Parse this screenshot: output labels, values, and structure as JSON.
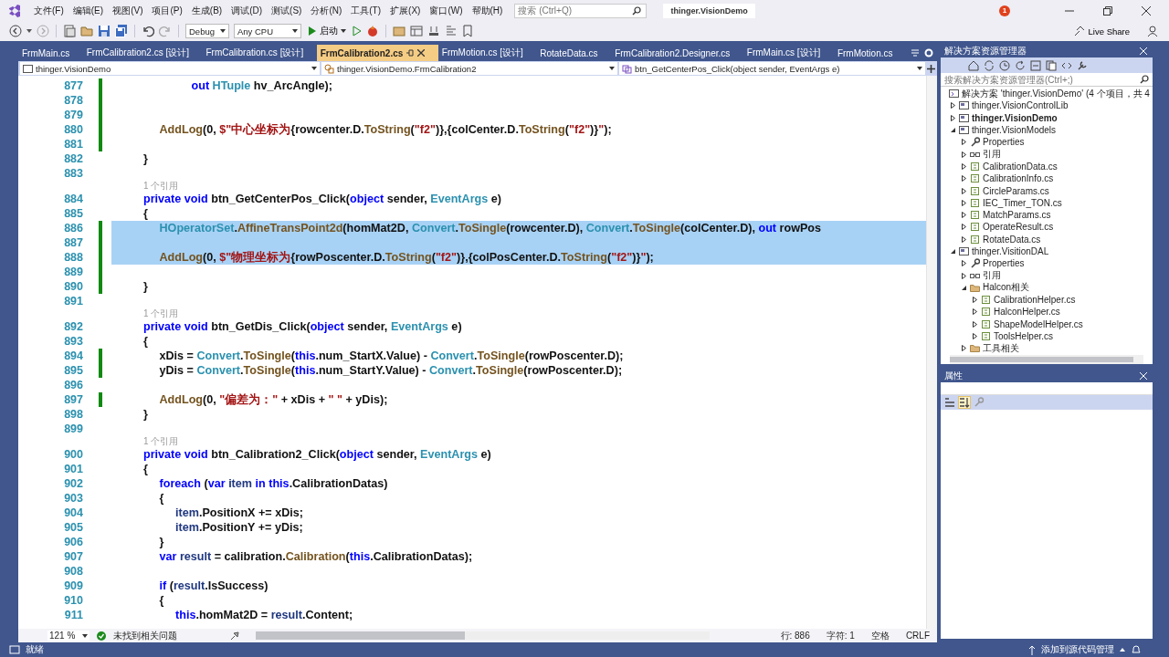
{
  "window": {
    "title": "thinger.VisionDemo",
    "notifications": "1"
  },
  "menu": [
    "文件(F)",
    "编辑(E)",
    "视图(V)",
    "项目(P)",
    "生成(B)",
    "调试(D)",
    "测试(S)",
    "分析(N)",
    "工具(T)",
    "扩展(X)",
    "窗口(W)",
    "帮助(H)"
  ],
  "search": {
    "placeholder": "搜索 (Ctrl+Q)"
  },
  "toolbar": {
    "configuration": "Debug",
    "platform": "Any CPU",
    "start_label": "启动",
    "live_share": "Live Share"
  },
  "tabs": [
    {
      "label": "FrmMain.cs",
      "selected": false
    },
    {
      "label": "FrmCalibration2.cs [设计]",
      "selected": false
    },
    {
      "label": "FrmCalibration.cs [设计]",
      "selected": false
    },
    {
      "label": "FrmCalibration2.cs",
      "selected": true
    },
    {
      "label": "FrmMotion.cs [设计]",
      "selected": false
    },
    {
      "label": "RotateData.cs",
      "selected": false
    },
    {
      "label": "FrmCalibration2.Designer.cs",
      "selected": false
    },
    {
      "label": "FrmMain.cs [设计]",
      "selected": false
    },
    {
      "label": "FrmMotion.cs",
      "selected": false
    }
  ],
  "navigation": {
    "project": "thinger.VisionDemo",
    "class": "thinger.VisionDemo.FrmCalibration2",
    "member": "btn_GetCenterPos_Click(object sender, EventArgs e)"
  },
  "code": {
    "rows": [
      {
        "kind": "line",
        "number": "877",
        "changed": true,
        "selected": false,
        "tokens": [
          {
            "text": "\t\t\t\t\tout ",
            "kind": "kw"
          },
          {
            "text": "HTuple",
            "kind": "type"
          },
          {
            "text": " hv_ArcAngle);",
            "kind": "plain"
          }
        ]
      },
      {
        "kind": "line",
        "number": "878",
        "changed": true,
        "selected": false,
        "tokens": []
      },
      {
        "kind": "line",
        "number": "879",
        "changed": true,
        "selected": false,
        "tokens": []
      },
      {
        "kind": "line",
        "number": "880",
        "changed": true,
        "selected": false,
        "tokens": [
          {
            "text": "\t\t\tAddLog",
            "kind": "method"
          },
          {
            "text": "(0, ",
            "kind": "plain"
          },
          {
            "text": "$\"中心坐标为",
            "kind": "str"
          },
          {
            "text": "{rowcenter.D.",
            "kind": "plain"
          },
          {
            "text": "ToString",
            "kind": "method"
          },
          {
            "text": "(",
            "kind": "plain"
          },
          {
            "text": "\"f2\"",
            "kind": "str"
          },
          {
            "text": ")},{colCenter.D.",
            "kind": "plain"
          },
          {
            "text": "ToString",
            "kind": "method"
          },
          {
            "text": "(",
            "kind": "plain"
          },
          {
            "text": "\"f2\"",
            "kind": "str"
          },
          {
            "text": ")}",
            "kind": "plain"
          },
          {
            "text": "\"",
            "kind": "str"
          },
          {
            "text": ");",
            "kind": "plain"
          }
        ]
      },
      {
        "kind": "line",
        "number": "881",
        "changed": true,
        "selected": false,
        "tokens": []
      },
      {
        "kind": "line",
        "number": "882",
        "changed": false,
        "selected": false,
        "tokens": [
          {
            "text": "\t\t}",
            "kind": "plain"
          }
        ]
      },
      {
        "kind": "line",
        "number": "883",
        "changed": false,
        "selected": false,
        "tokens": []
      },
      {
        "kind": "lens",
        "text": "1 个引用"
      },
      {
        "kind": "line",
        "number": "884",
        "changed": false,
        "selected": false,
        "tokens": [
          {
            "text": "\t\tprivate void ",
            "kind": "kw"
          },
          {
            "text": "btn_GetCenterPos_Click(",
            "kind": "plain"
          },
          {
            "text": "object ",
            "kind": "kw"
          },
          {
            "text": "sender, ",
            "kind": "plain"
          },
          {
            "text": "EventArgs",
            "kind": "type"
          },
          {
            "text": " e)",
            "kind": "plain"
          }
        ]
      },
      {
        "kind": "line",
        "number": "885",
        "changed": false,
        "selected": false,
        "tokens": [
          {
            "text": "\t\t{",
            "kind": "plain"
          }
        ]
      },
      {
        "kind": "line",
        "number": "886",
        "changed": true,
        "selected": true,
        "tokens": [
          {
            "text": "\t\t\tHOperatorSet",
            "kind": "type"
          },
          {
            "text": ".",
            "kind": "plain"
          },
          {
            "text": "AffineTransPoint2d",
            "kind": "method"
          },
          {
            "text": "(homMat2D, ",
            "kind": "plain"
          },
          {
            "text": "Convert",
            "kind": "type"
          },
          {
            "text": ".",
            "kind": "plain"
          },
          {
            "text": "ToSingle",
            "kind": "method"
          },
          {
            "text": "(rowcenter.D), ",
            "kind": "plain"
          },
          {
            "text": "Convert",
            "kind": "type"
          },
          {
            "text": ".",
            "kind": "plain"
          },
          {
            "text": "ToSingle",
            "kind": "method"
          },
          {
            "text": "(colCenter.D), ",
            "kind": "plain"
          },
          {
            "text": "out ",
            "kind": "kw"
          },
          {
            "text": "rowPos",
            "kind": "plain"
          }
        ]
      },
      {
        "kind": "line",
        "number": "887",
        "changed": true,
        "selected": true,
        "tokens": []
      },
      {
        "kind": "line",
        "number": "888",
        "changed": true,
        "selected": true,
        "tokens": [
          {
            "text": "\t\t\tAddLog",
            "kind": "method"
          },
          {
            "text": "(0, ",
            "kind": "plain"
          },
          {
            "text": "$\"物理坐标为",
            "kind": "str"
          },
          {
            "text": "{rowPoscenter.D.",
            "kind": "plain"
          },
          {
            "text": "ToString",
            "kind": "method"
          },
          {
            "text": "(",
            "kind": "plain"
          },
          {
            "text": "\"f2\"",
            "kind": "str"
          },
          {
            "text": ")},{colPosCenter.D.",
            "kind": "plain"
          },
          {
            "text": "ToString",
            "kind": "method"
          },
          {
            "text": "(",
            "kind": "plain"
          },
          {
            "text": "\"f2\"",
            "kind": "str"
          },
          {
            "text": ")}",
            "kind": "plain"
          },
          {
            "text": "\"",
            "kind": "str"
          },
          {
            "text": ");",
            "kind": "plain"
          }
        ]
      },
      {
        "kind": "line",
        "number": "889",
        "changed": true,
        "selected": false,
        "tokens": []
      },
      {
        "kind": "line",
        "number": "890",
        "changed": true,
        "selected": false,
        "tokens": [
          {
            "text": "\t\t}",
            "kind": "plain"
          }
        ]
      },
      {
        "kind": "line",
        "number": "891",
        "changed": false,
        "selected": false,
        "tokens": []
      },
      {
        "kind": "lens",
        "text": "1 个引用"
      },
      {
        "kind": "line",
        "number": "892",
        "changed": false,
        "selected": false,
        "tokens": [
          {
            "text": "\t\tprivate void ",
            "kind": "kw"
          },
          {
            "text": "btn_GetDis_Click(",
            "kind": "plain"
          },
          {
            "text": "object ",
            "kind": "kw"
          },
          {
            "text": "sender, ",
            "kind": "plain"
          },
          {
            "text": "EventArgs",
            "kind": "type"
          },
          {
            "text": " e)",
            "kind": "plain"
          }
        ]
      },
      {
        "kind": "line",
        "number": "893",
        "changed": false,
        "selected": false,
        "tokens": [
          {
            "text": "\t\t{",
            "kind": "plain"
          }
        ]
      },
      {
        "kind": "line",
        "number": "894",
        "changed": true,
        "selected": false,
        "tokens": [
          {
            "text": "\t\t\txDis = ",
            "kind": "plain"
          },
          {
            "text": "Convert",
            "kind": "type"
          },
          {
            "text": ".",
            "kind": "plain"
          },
          {
            "text": "ToSingle",
            "kind": "method"
          },
          {
            "text": "(",
            "kind": "plain"
          },
          {
            "text": "this",
            "kind": "kw"
          },
          {
            "text": ".num_StartX.Value) - ",
            "kind": "plain"
          },
          {
            "text": "Convert",
            "kind": "type"
          },
          {
            "text": ".",
            "kind": "plain"
          },
          {
            "text": "ToSingle",
            "kind": "method"
          },
          {
            "text": "(rowPoscenter.D);",
            "kind": "plain"
          }
        ]
      },
      {
        "kind": "line",
        "number": "895",
        "changed": true,
        "selected": false,
        "tokens": [
          {
            "text": "\t\t\tyDis = ",
            "kind": "plain"
          },
          {
            "text": "Convert",
            "kind": "type"
          },
          {
            "text": ".",
            "kind": "plain"
          },
          {
            "text": "ToSingle",
            "kind": "method"
          },
          {
            "text": "(",
            "kind": "plain"
          },
          {
            "text": "this",
            "kind": "kw"
          },
          {
            "text": ".num_StartY.Value) - ",
            "kind": "plain"
          },
          {
            "text": "Convert",
            "kind": "type"
          },
          {
            "text": ".",
            "kind": "plain"
          },
          {
            "text": "ToSingle",
            "kind": "method"
          },
          {
            "text": "(rowPoscenter.D);",
            "kind": "plain"
          }
        ]
      },
      {
        "kind": "line",
        "number": "896",
        "changed": false,
        "selected": false,
        "tokens": []
      },
      {
        "kind": "line",
        "number": "897",
        "changed": true,
        "selected": false,
        "tokens": [
          {
            "text": "\t\t\tAddLog",
            "kind": "method"
          },
          {
            "text": "(0, ",
            "kind": "plain"
          },
          {
            "text": "\"偏差为：\"",
            "kind": "str"
          },
          {
            "text": " + xDis + ",
            "kind": "plain"
          },
          {
            "text": "\" \"",
            "kind": "str"
          },
          {
            "text": " + yDis);",
            "kind": "plain"
          }
        ]
      },
      {
        "kind": "line",
        "number": "898",
        "changed": false,
        "selected": false,
        "tokens": [
          {
            "text": "\t\t}",
            "kind": "plain"
          }
        ]
      },
      {
        "kind": "line",
        "number": "899",
        "changed": false,
        "selected": false,
        "tokens": []
      },
      {
        "kind": "lens",
        "text": "1 个引用"
      },
      {
        "kind": "line",
        "number": "900",
        "changed": false,
        "selected": false,
        "tokens": [
          {
            "text": "\t\tprivate void ",
            "kind": "kw"
          },
          {
            "text": "btn_Calibration2_Click(",
            "kind": "plain"
          },
          {
            "text": "object ",
            "kind": "kw"
          },
          {
            "text": "sender, ",
            "kind": "plain"
          },
          {
            "text": "EventArgs",
            "kind": "type"
          },
          {
            "text": " e)",
            "kind": "plain"
          }
        ]
      },
      {
        "kind": "line",
        "number": "901",
        "changed": false,
        "selected": false,
        "tokens": [
          {
            "text": "\t\t{",
            "kind": "plain"
          }
        ]
      },
      {
        "kind": "line",
        "number": "902",
        "changed": false,
        "selected": false,
        "tokens": [
          {
            "text": "\t\t\tforeach ",
            "kind": "kw"
          },
          {
            "text": "(",
            "kind": "plain"
          },
          {
            "text": "var ",
            "kind": "kw"
          },
          {
            "text": "item ",
            "kind": "var"
          },
          {
            "text": "in this",
            "kind": "kw"
          },
          {
            "text": ".CalibrationDatas)",
            "kind": "plain"
          }
        ]
      },
      {
        "kind": "line",
        "number": "903",
        "changed": false,
        "selected": false,
        "tokens": [
          {
            "text": "\t\t\t{",
            "kind": "plain"
          }
        ]
      },
      {
        "kind": "line",
        "number": "904",
        "changed": false,
        "selected": false,
        "tokens": [
          {
            "text": "\t\t\t\titem",
            "kind": "var"
          },
          {
            "text": ".PositionX += xDis;",
            "kind": "plain"
          }
        ]
      },
      {
        "kind": "line",
        "number": "905",
        "changed": false,
        "selected": false,
        "tokens": [
          {
            "text": "\t\t\t\titem",
            "kind": "var"
          },
          {
            "text": ".PositionY += yDis;",
            "kind": "plain"
          }
        ]
      },
      {
        "kind": "line",
        "number": "906",
        "changed": false,
        "selected": false,
        "tokens": [
          {
            "text": "\t\t\t}",
            "kind": "plain"
          }
        ]
      },
      {
        "kind": "line",
        "number": "907",
        "changed": false,
        "selected": false,
        "tokens": [
          {
            "text": "\t\t\tvar ",
            "kind": "kw"
          },
          {
            "text": "result",
            "kind": "var"
          },
          {
            "text": " = calibration.",
            "kind": "plain"
          },
          {
            "text": "Calibration",
            "kind": "method"
          },
          {
            "text": "(",
            "kind": "plain"
          },
          {
            "text": "this",
            "kind": "kw"
          },
          {
            "text": ".CalibrationDatas);",
            "kind": "plain"
          }
        ]
      },
      {
        "kind": "line",
        "number": "908",
        "changed": false,
        "selected": false,
        "tokens": []
      },
      {
        "kind": "line",
        "number": "909",
        "changed": false,
        "selected": false,
        "tokens": [
          {
            "text": "\t\t\tif ",
            "kind": "kw"
          },
          {
            "text": "(",
            "kind": "plain"
          },
          {
            "text": "result",
            "kind": "var"
          },
          {
            "text": ".IsSuccess)",
            "kind": "plain"
          }
        ]
      },
      {
        "kind": "line",
        "number": "910",
        "changed": false,
        "selected": false,
        "tokens": [
          {
            "text": "\t\t\t{",
            "kind": "plain"
          }
        ]
      },
      {
        "kind": "line",
        "number": "911",
        "changed": false,
        "selected": false,
        "tokens": [
          {
            "text": "\t\t\t\tthis",
            "kind": "kw"
          },
          {
            "text": ".homMat2D = ",
            "kind": "plain"
          },
          {
            "text": "result",
            "kind": "var"
          },
          {
            "text": ".Content;",
            "kind": "plain"
          }
        ]
      }
    ]
  },
  "editor_status": {
    "zoom": "121 %",
    "issues": "未找到相关问题",
    "line": "行: 886",
    "char": "字符: 1",
    "whitespace": "空格",
    "line_ending": "CRLF"
  },
  "solution_explorer": {
    "title": "解决方案资源管理器",
    "search_placeholder": "搜索解决方案资源管理器(Ctrl+;)",
    "solution": {
      "label": "解决方案 'thinger.VisionDemo' (4 个项目，共 4",
      "children": [
        {
          "label": "thinger.VisionControlLib",
          "kind": "project",
          "startup": false,
          "expanded": false
        },
        {
          "label": "thinger.VisionDemo",
          "kind": "project",
          "startup": true,
          "expanded": false
        },
        {
          "label": "thinger.VisionModels",
          "kind": "project",
          "startup": false,
          "expanded": true,
          "children": [
            {
              "label": "Properties",
              "kind": "properties",
              "expanded": false
            },
            {
              "label": "引用",
              "kind": "references",
              "expanded": false
            },
            {
              "label": "CalibrationData.cs",
              "kind": "file",
              "expanded": false
            },
            {
              "label": "CalibrationInfo.cs",
              "kind": "file",
              "expanded": false
            },
            {
              "label": "CircleParams.cs",
              "kind": "file",
              "expanded": false
            },
            {
              "label": "IEC_Timer_TON.cs",
              "kind": "file",
              "expanded": false
            },
            {
              "label": "MatchParams.cs",
              "kind": "file",
              "expanded": false
            },
            {
              "label": "OperateResult.cs",
              "kind": "file",
              "expanded": false
            },
            {
              "label": "RotateData.cs",
              "kind": "file",
              "expanded": false
            }
          ]
        },
        {
          "label": "thinger.VisitionDAL",
          "kind": "project",
          "startup": false,
          "expanded": true,
          "children": [
            {
              "label": "Properties",
              "kind": "properties",
              "expanded": false
            },
            {
              "label": "引用",
              "kind": "references",
              "expanded": false
            },
            {
              "label": "Halcon相关",
              "kind": "folder",
              "expanded": true,
              "children": [
                {
                  "label": "CalibrationHelper.cs",
                  "kind": "file",
                  "expanded": false
                },
                {
                  "label": "HalconHelper.cs",
                  "kind": "file",
                  "expanded": false
                },
                {
                  "label": "ShapeModelHelper.cs",
                  "kind": "file",
                  "expanded": false
                },
                {
                  "label": "ToolsHelper.cs",
                  "kind": "file",
                  "expanded": false
                }
              ]
            },
            {
              "label": "工具相关",
              "kind": "folder",
              "expanded": false
            }
          ]
        }
      ]
    }
  },
  "properties": {
    "title": "属性"
  },
  "status_bar": {
    "text": "就绪",
    "source_control": "添加到源代码管理"
  }
}
